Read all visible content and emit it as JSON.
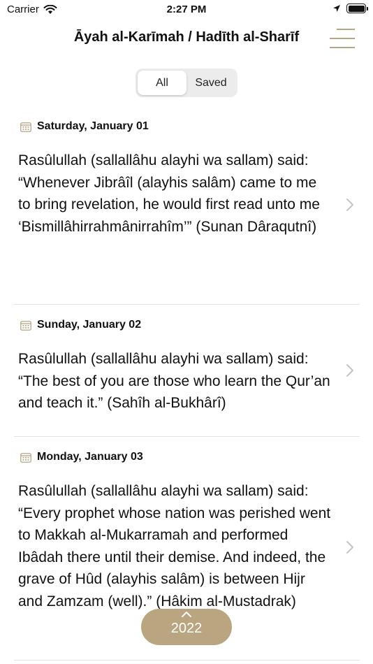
{
  "status_bar": {
    "carrier": "Carrier",
    "time": "2:27 PM"
  },
  "nav": {
    "title": "Āyah al-Karīmah / Hadīth al-Sharīf",
    "menu_icon": "hamburger-menu-icon"
  },
  "segments": [
    {
      "label": "All",
      "selected": true
    },
    {
      "label": "Saved",
      "selected": false
    }
  ],
  "entries": [
    {
      "date": "Saturday, January 01",
      "text": "Rasûlullah (sallallâhu alayhi wa sallam) said: “Whenever Jibrâîl (alayhis salâm) came to me to bring revelation, he would first read unto me ‘Bismillâhirrahmânirrahîm’” (Sunan Dâraqutnî)"
    },
    {
      "date": "Sunday, January 02",
      "text": "Rasûlullah (sallallâhu alayhi wa sallam) said: “The best of you are those who learn the Qur’an and teach it.” (Sahîh al-Bukhârî)"
    },
    {
      "date": "Monday, January 03",
      "text": "Rasûlullah (sallallâhu alayhi wa sallam) said:  “Every prophet whose nation was perished went to Makkah al-Mukarramah and performed Ibâdah there until their demise. And indeed, the grave of Hûd (alayhis salâm) is between Hijr and Zamzam (well).” (Hâkim al-Mustadrak)"
    }
  ],
  "year_button": {
    "label": "2022"
  },
  "colors": {
    "accent": "#b7a586",
    "year_button_bg": "#b6a07a"
  }
}
